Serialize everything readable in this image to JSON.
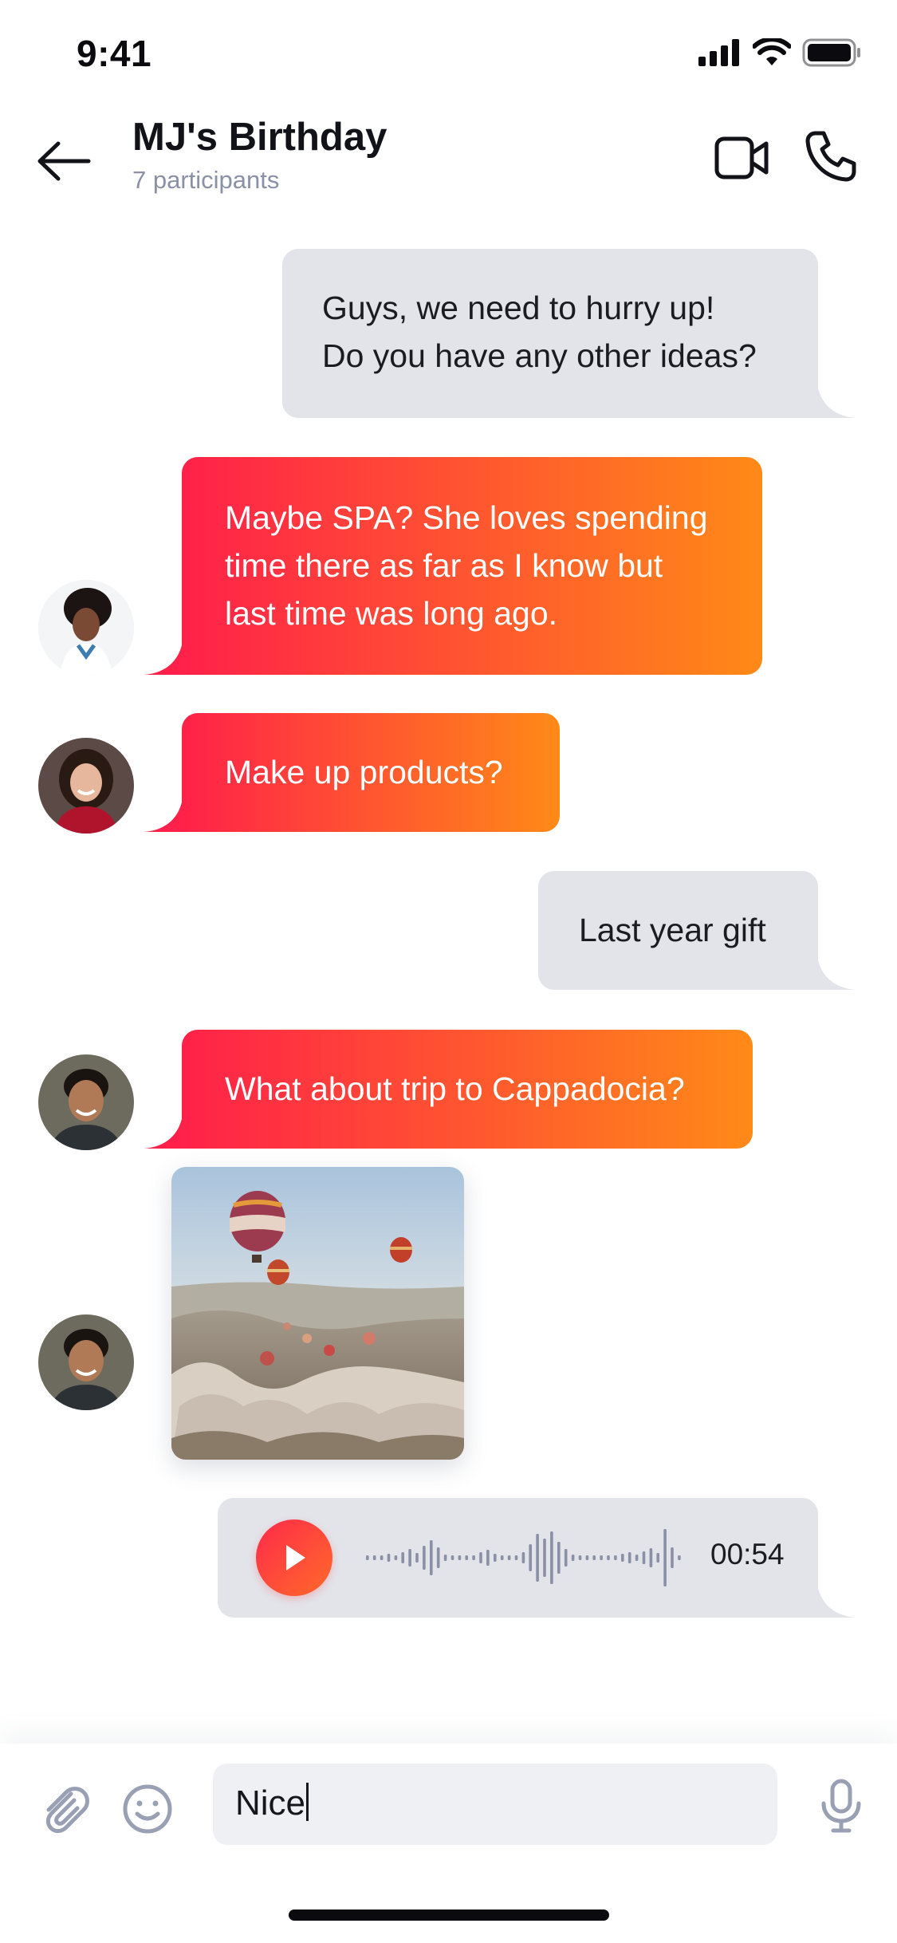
{
  "status_bar": {
    "time": "9:41"
  },
  "header": {
    "title": "MJ's Birthday",
    "subtitle": "7 participants",
    "icons": {
      "back": "arrow-left-icon",
      "video": "video-camera-icon",
      "call": "phone-icon"
    }
  },
  "messages": [
    {
      "direction": "outgoing",
      "text": "Guys, we need to hurry up!\nDo you have any other ideas?"
    },
    {
      "direction": "incoming",
      "text": "Maybe SPA? She loves spending\ntime there as far as I know but\nlast time was long ago."
    },
    {
      "direction": "incoming",
      "text": "Make up products?"
    },
    {
      "direction": "outgoing",
      "text": "Last year gift"
    },
    {
      "direction": "incoming",
      "text": "What about trip to Cappadocia?"
    },
    {
      "direction": "incoming",
      "type": "image",
      "description": "hot-air-balloons-photo"
    },
    {
      "direction": "outgoing",
      "type": "audio",
      "duration": "00:54"
    }
  ],
  "composer": {
    "input_value": "Nice",
    "icons": {
      "attach": "paperclip-icon",
      "emoji": "smiley-icon",
      "mic": "microphone-icon"
    }
  },
  "colors": {
    "gradient_start": "#ff2149",
    "gradient_end": "#ff8a17",
    "outgoing_bubble": "#e2e4ea",
    "muted_text": "#8a90a6",
    "icon_gray": "#9aa0b4"
  }
}
